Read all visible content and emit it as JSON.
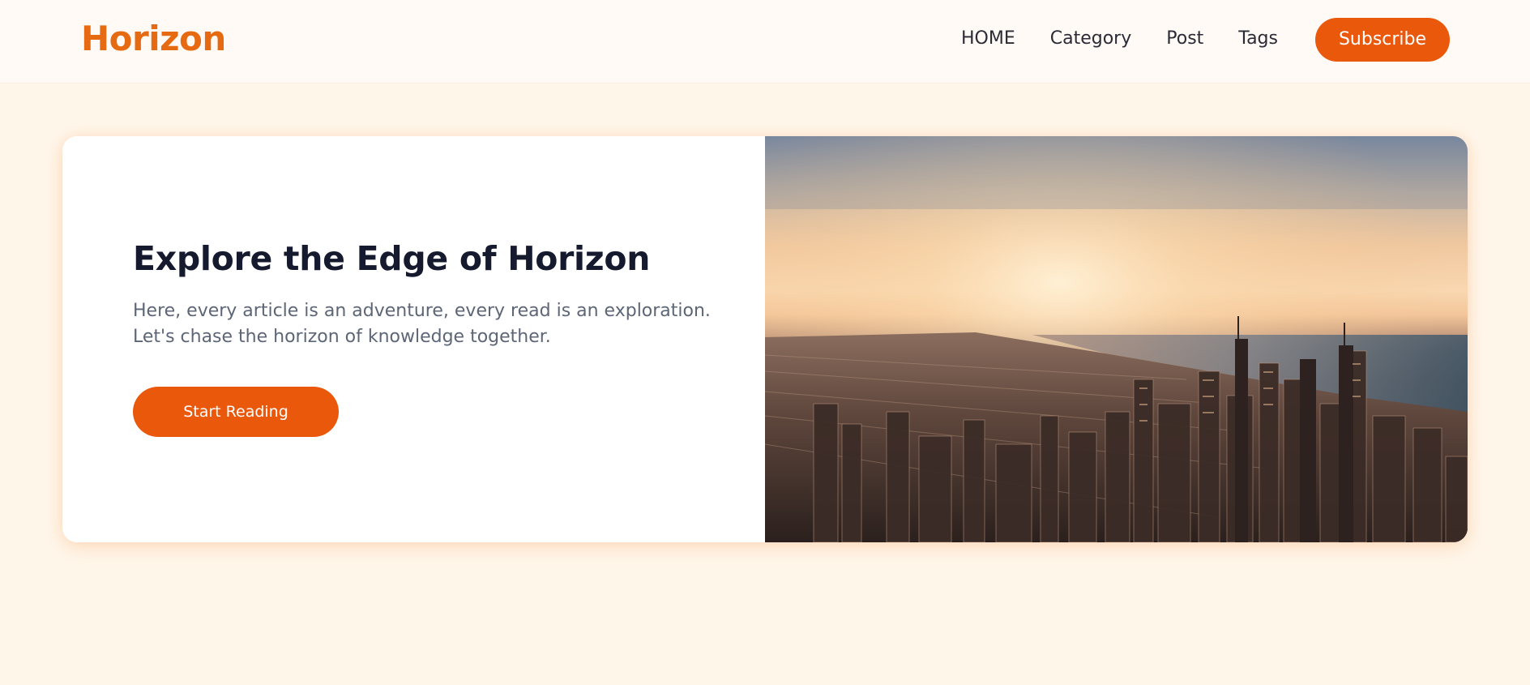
{
  "brand": {
    "name": "Horizon",
    "color": "#e56a12"
  },
  "nav": {
    "items": [
      {
        "label": "HOME"
      },
      {
        "label": "Category"
      },
      {
        "label": "Post"
      },
      {
        "label": "Tags"
      }
    ],
    "subscribe_label": "Subscribe"
  },
  "hero": {
    "title": "Explore the Edge of Horizon",
    "text_line_1": "Here, every article is an adventure, every read is an exploration.",
    "text_line_2": "Let's chase the horizon of knowledge together.",
    "cta_label": "Start Reading",
    "image_icon": "city-skyline-photo"
  },
  "colors": {
    "accent": "#ea580c",
    "page_background": "#fff6ea",
    "title_text": "#151a2e",
    "body_text": "#5d6677"
  }
}
